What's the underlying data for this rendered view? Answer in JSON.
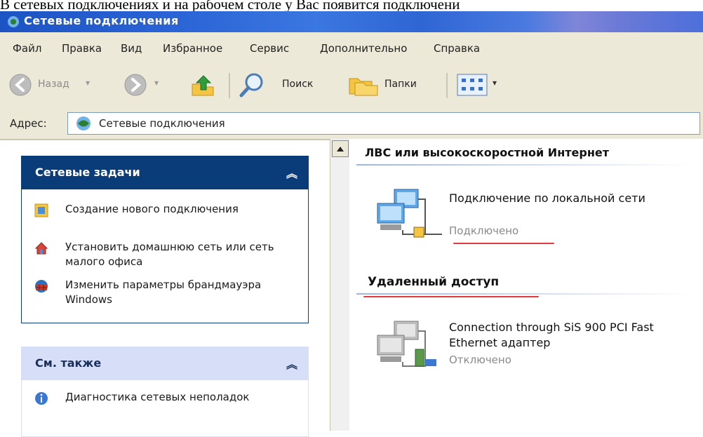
{
  "caption": "В сетевых подключениях и на рабочем столе у Вас появится подключени",
  "window": {
    "title": "Сетевые подключения"
  },
  "menu": [
    "Файл",
    "Правка",
    "Вид",
    "Избранное",
    "Сервис",
    "Дополнительно",
    "Справка"
  ],
  "toolbar": {
    "back_label": "Назад",
    "search_label": "Поиск",
    "folders_label": "Папки"
  },
  "address": {
    "label": "Адрес:",
    "value": "Сетевые подключения"
  },
  "network_tasks": {
    "title": "Сетевые задачи",
    "items": [
      {
        "label": "Создание нового подключения",
        "icon": "new-connection-icon"
      },
      {
        "label": "Установить домашнюю сеть или сеть малого офиса",
        "icon": "home-network-icon"
      },
      {
        "label": "Изменить параметры брандмауэра Windows",
        "icon": "firewall-icon"
      }
    ]
  },
  "see_also": {
    "title": "См. также",
    "items": [
      {
        "label": "Диагностика сетевых неполадок",
        "icon": "info-icon"
      }
    ]
  },
  "groups": [
    {
      "title": "ЛВС или высокоскоростной Интернет",
      "connection": {
        "name": "Подключение по локальной сети",
        "status": "Подключено"
      }
    },
    {
      "title": "Удаленный доступ",
      "connection": {
        "name": "Connection through SiS 900 PCI Fast Ethernet адаптер",
        "status": "Отключено"
      }
    }
  ],
  "colors": {
    "titlebar": "#2a64d6",
    "panel_header": "#0a3c7a",
    "annotation_red": "#e23a3a"
  }
}
